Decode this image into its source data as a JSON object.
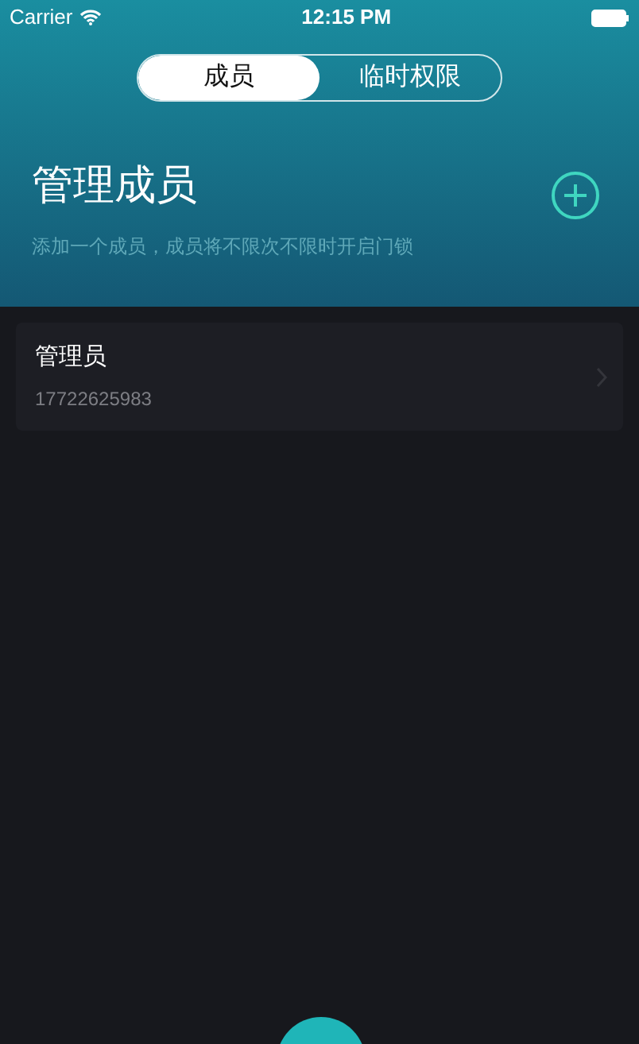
{
  "status_bar": {
    "carrier": "Carrier",
    "time": "12:15 PM"
  },
  "tabs": [
    {
      "label": "成员",
      "selected": true
    },
    {
      "label": "临时权限",
      "selected": false
    }
  ],
  "header": {
    "title": "管理成员",
    "subtitle": "添加一个成员，成员将不限次不限时开启门锁"
  },
  "members": [
    {
      "name": "管理员",
      "phone": "17722625983"
    }
  ]
}
